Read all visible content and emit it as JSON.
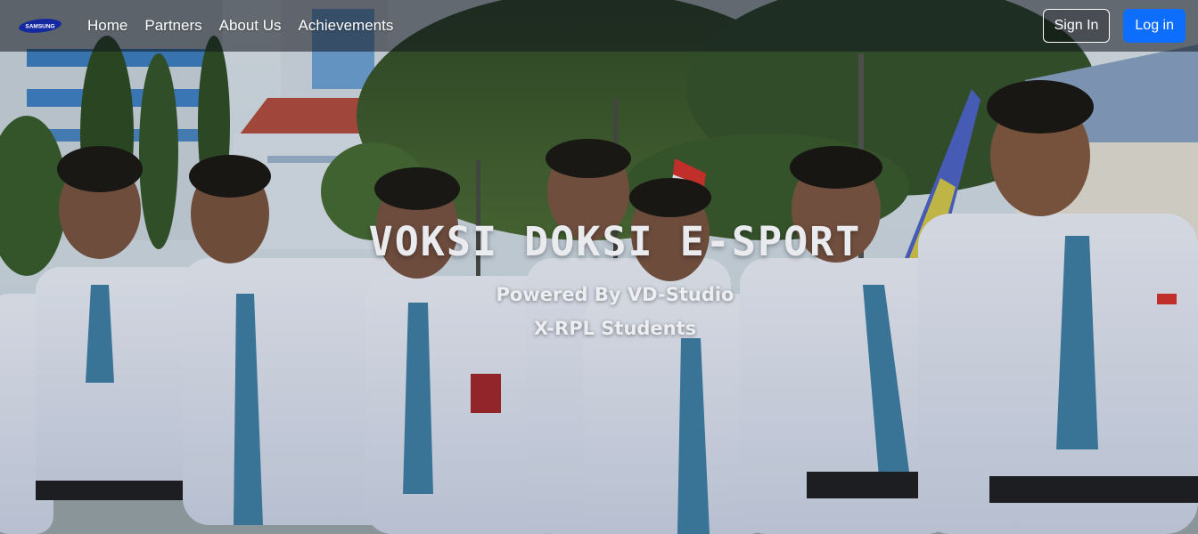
{
  "navbar": {
    "brand_text": "SAMSUNG",
    "links": [
      "Home",
      "Partners",
      "About Us",
      "Achievements"
    ],
    "sign_in_label": "Sign In",
    "log_in_label": "Log in"
  },
  "hero": {
    "title": "VOKSI DOKSI E-SPORT",
    "subtitle_line1": "Powered By VD-Studio",
    "subtitle_line2": "X-RPL Students"
  },
  "colors": {
    "primary_button": "#0d6efd",
    "navbar_overlay": "rgba(18,22,30,0.55)",
    "uniform_shirt": "#e3e8f3",
    "tie": "#3f7fa6",
    "samsung_blue": "#1428a0"
  },
  "icons": {
    "brand_logo": "samsung-logo"
  }
}
